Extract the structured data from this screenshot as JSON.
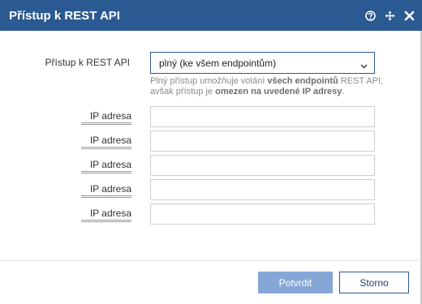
{
  "dialog": {
    "title": "Přístup k REST API",
    "icons": [
      "help-icon",
      "move-icon",
      "close-icon"
    ]
  },
  "access": {
    "label": "Přístup k REST API",
    "selected": "plný (ke všem endpointům)",
    "hint_part1": "Plný přístup umožňuje volání ",
    "hint_bold1": "všech endpointů",
    "hint_part2": " REST API, avšak přístup je ",
    "hint_bold2": "omezen na uvedené IP adresy",
    "hint_part3": "."
  },
  "ip_rows": [
    {
      "label": "IP adresa",
      "value": ""
    },
    {
      "label": "IP adresa",
      "value": ""
    },
    {
      "label": "IP adresa",
      "value": ""
    },
    {
      "label": "IP adresa",
      "value": ""
    },
    {
      "label": "IP adresa",
      "value": ""
    }
  ],
  "footer": {
    "confirm_label": "Potvrdit",
    "cancel_label": "Storno"
  },
  "colors": {
    "header": "#2b5a92",
    "confirm_button": "#86a7d6"
  }
}
